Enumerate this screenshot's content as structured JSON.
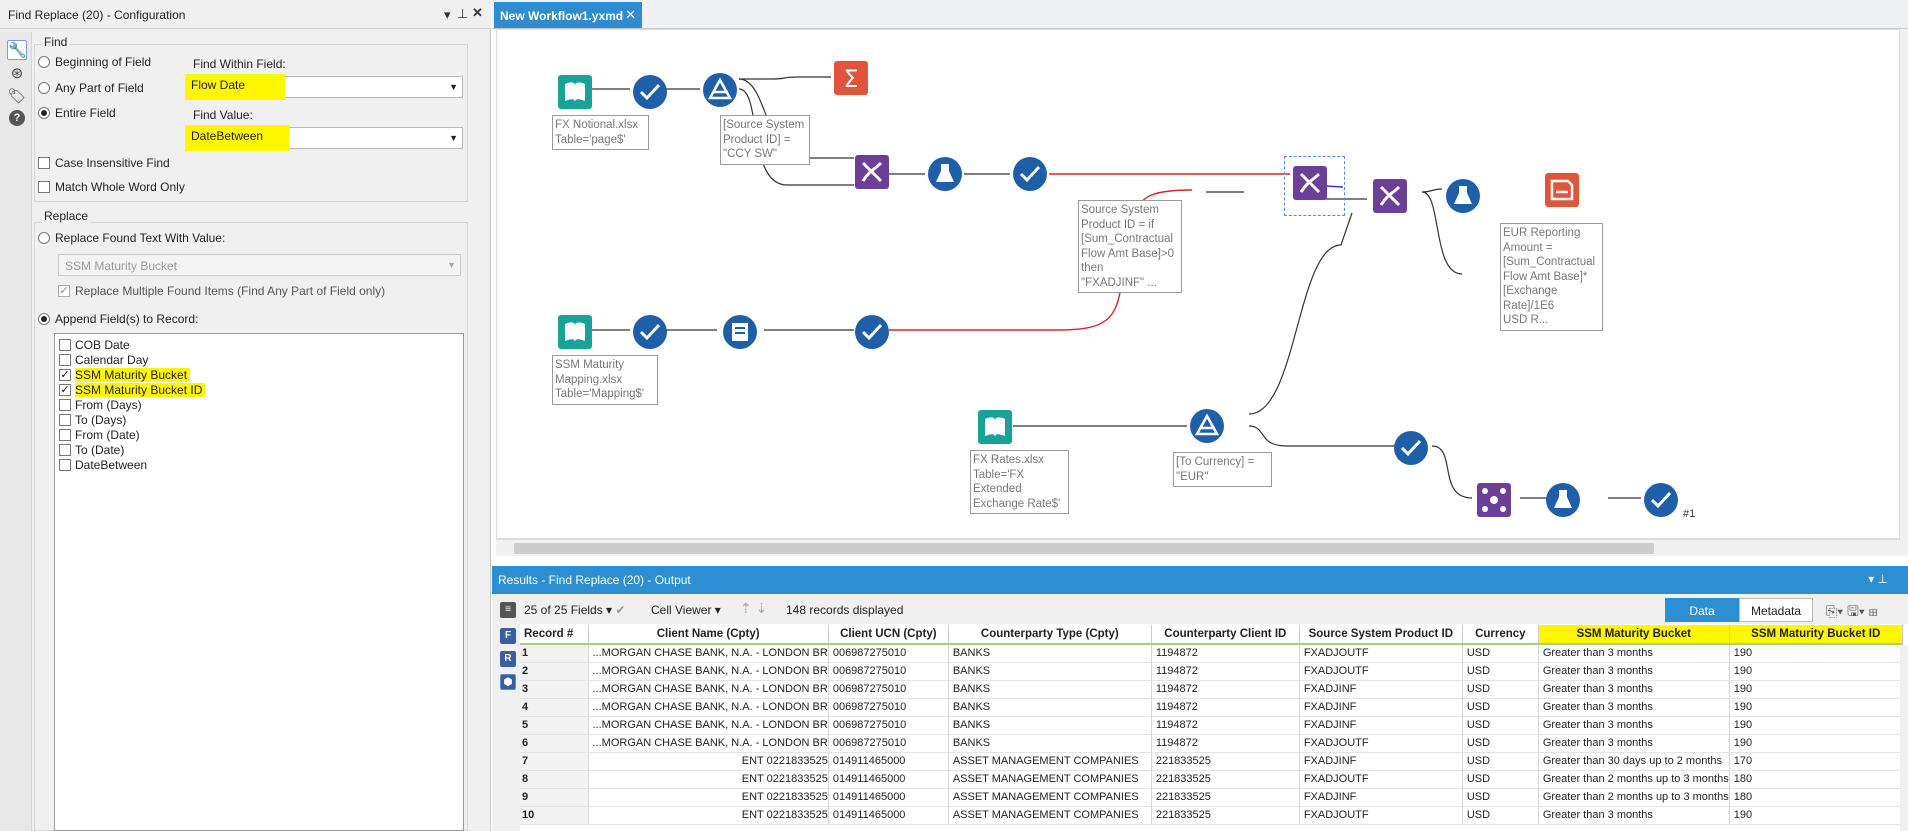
{
  "config_panel": {
    "title": "Find Replace (20) - Configuration",
    "find_section": "Find",
    "find_options": [
      "Beginning of Field",
      "Any Part of Field",
      "Entire Field"
    ],
    "find_within_label": "Find Within Field:",
    "find_within_value": "Flow Date",
    "find_value_label": "Find Value:",
    "find_value_value": "DateBetween",
    "case_insensitive": "Case Insensitive Find",
    "match_whole_word": "Match Whole Word Only",
    "replace_section": "Replace",
    "replace_found_label": "Replace Found Text With Value:",
    "replace_found_value": "SSM Maturity Bucket",
    "replace_multiple": "Replace Multiple Found Items (Find Any Part of Field only)",
    "append_label": "Append Field(s) to Record:",
    "append_fields": [
      {
        "name": "COB Date",
        "checked": false
      },
      {
        "name": "Calendar Day",
        "checked": false
      },
      {
        "name": "SSM Maturity Bucket",
        "checked": true
      },
      {
        "name": "SSM Maturity Bucket ID",
        "checked": true
      },
      {
        "name": "From (Days)",
        "checked": false
      },
      {
        "name": "To (Days)",
        "checked": false
      },
      {
        "name": "From (Date)",
        "checked": false
      },
      {
        "name": "To (Date)",
        "checked": false
      },
      {
        "name": "DateBetween",
        "checked": false
      }
    ]
  },
  "workflow_tab": {
    "label": "New Workflow1.yxmd"
  },
  "annotations": {
    "fx_notional": "FX Notional.xlsx\nTable='page$'",
    "filter1": "[Source System\nProduct ID] =\n\"CCY SW\"",
    "formula1": "Source System\nProduct ID = if\n[Sum_Contractual\nFlow Amt Base]>0\nthen\n\"FXADJINF\" ...",
    "eur_reporting": "EUR Reporting\nAmount =\n[Sum_Contractual\nFlow Amt Base]*\n[Exchange\nRate]/1E6\nUSD R...",
    "ssm_mapping": "SSM Maturity\nMapping.xlsx\nTable='Mapping$'",
    "fx_rates": "FX Rates.xlsx\nTable='FX\nExtended\nExchange Rate$'",
    "filter2": "[To Currency] =\n\"EUR\"",
    "browse_label": "#1"
  },
  "results": {
    "title": "Results - Find Replace (20) - Output",
    "fields_dropdown": "25 of 25 Fields",
    "viewer_dropdown": "Cell Viewer",
    "records_displayed": "148 records displayed",
    "tab_data": "Data",
    "tab_metadata": "Metadata",
    "columns": [
      "Record #",
      "Client Name (Cpty)",
      "Client UCN (Cpty)",
      "Counterparty Type (Cpty)",
      "Counterparty Client ID",
      "Source System Product ID",
      "Currency",
      "SSM Maturity Bucket",
      "SSM Maturity Bucket ID"
    ],
    "rows": [
      [
        "1",
        "MORGAN CHASE BANK, N.A. - LONDON BR...",
        "006987275010",
        "BANKS",
        "1194872",
        "FXADJOUTF",
        "USD",
        "Greater than 3 months",
        "190"
      ],
      [
        "2",
        "MORGAN CHASE BANK, N.A. - LONDON BR...",
        "006987275010",
        "BANKS",
        "1194872",
        "FXADJOUTF",
        "USD",
        "Greater than 3 months",
        "190"
      ],
      [
        "3",
        "MORGAN CHASE BANK, N.A. - LONDON BR...",
        "006987275010",
        "BANKS",
        "1194872",
        "FXADJINF",
        "USD",
        "Greater than 3 months",
        "190"
      ],
      [
        "4",
        "MORGAN CHASE BANK, N.A. - LONDON BR...",
        "006987275010",
        "BANKS",
        "1194872",
        "FXADJINF",
        "USD",
        "Greater than 3 months",
        "190"
      ],
      [
        "5",
        "MORGAN CHASE BANK, N.A. - LONDON BR...",
        "006987275010",
        "BANKS",
        "1194872",
        "FXADJINF",
        "USD",
        "Greater than 3 months",
        "190"
      ],
      [
        "6",
        "MORGAN CHASE BANK, N.A. - LONDON BR...",
        "006987275010",
        "BANKS",
        "1194872",
        "FXADJOUTF",
        "USD",
        "Greater than 3 months",
        "190"
      ],
      [
        "7",
        "ENT 0221833525",
        "014911465000",
        "ASSET MANAGEMENT COMPANIES",
        "221833525",
        "FXADJINF",
        "USD",
        "Greater than 30 days up to 2 months",
        "170"
      ],
      [
        "8",
        "ENT 0221833525",
        "014911465000",
        "ASSET MANAGEMENT COMPANIES",
        "221833525",
        "FXADJOUTF",
        "USD",
        "Greater than 2 months up to 3 months",
        "180"
      ],
      [
        "9",
        "ENT 0221833525",
        "014911465000",
        "ASSET MANAGEMENT COMPANIES",
        "221833525",
        "FXADJINF",
        "USD",
        "Greater than 2 months up to 3 months",
        "180"
      ],
      [
        "10",
        "ENT 0221833525",
        "014911465000",
        "ASSET MANAGEMENT COMPANIES",
        "221833525",
        "FXADJOUTF",
        "USD",
        "Greater than 3 months",
        "190"
      ]
    ]
  },
  "colors": {
    "accent": "#2b8fd1",
    "highlight": "#fff700",
    "input_tool": "#1aa19a",
    "select_tool": "#1f5fa8",
    "join_tool": "#6b3f97",
    "summarize_tool": "#e0543c"
  }
}
